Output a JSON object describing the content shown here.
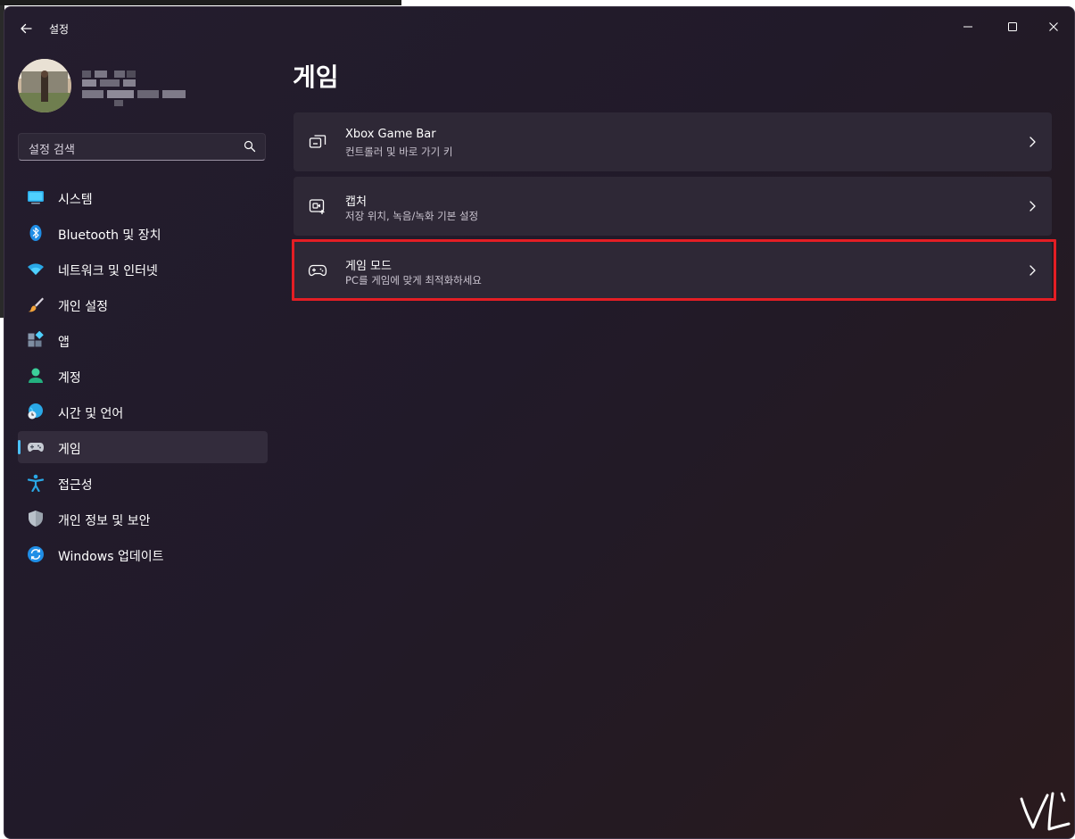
{
  "window": {
    "app_title": "설정",
    "controls": {
      "minimize": "minimize-icon",
      "maximize": "maximize-icon",
      "close": "close-icon"
    }
  },
  "profile": {
    "avatar": "avatar-photo"
  },
  "search": {
    "placeholder": "설정 검색",
    "icon": "search-icon"
  },
  "sidebar": {
    "items": [
      {
        "label": "시스템",
        "icon": "system-icon"
      },
      {
        "label": "Bluetooth 및 장치",
        "icon": "bluetooth-icon"
      },
      {
        "label": "네트워크 및 인터넷",
        "icon": "wifi-icon"
      },
      {
        "label": "개인 설정",
        "icon": "brush-icon"
      },
      {
        "label": "앱",
        "icon": "apps-icon"
      },
      {
        "label": "계정",
        "icon": "account-icon"
      },
      {
        "label": "시간 및 언어",
        "icon": "globe-clock-icon"
      },
      {
        "label": "게임",
        "icon": "gamepad-icon",
        "selected": true
      },
      {
        "label": "접근성",
        "icon": "accessibility-icon"
      },
      {
        "label": "개인 정보 및 보안",
        "icon": "shield-icon"
      },
      {
        "label": "Windows 업데이트",
        "icon": "update-icon"
      }
    ]
  },
  "main": {
    "title": "게임",
    "cards": [
      {
        "title": "Xbox Game Bar",
        "subtitle": "컨트롤러 및 바로 가기 키",
        "icon": "game-bar-icon"
      },
      {
        "title": "캡처",
        "subtitle": "저장 위치, 녹음/녹화 기본 설정",
        "icon": "capture-icon"
      },
      {
        "title": "게임 모드",
        "subtitle": "PC를 게임에 맞게 최적화하세요",
        "icon": "game-mode-icon",
        "highlighted": true
      }
    ]
  },
  "colors": {
    "accent": "#4cc2ff",
    "highlight_box": "#e41e24",
    "window_bg": "#221b2b",
    "card_bg": "#2e2836"
  }
}
